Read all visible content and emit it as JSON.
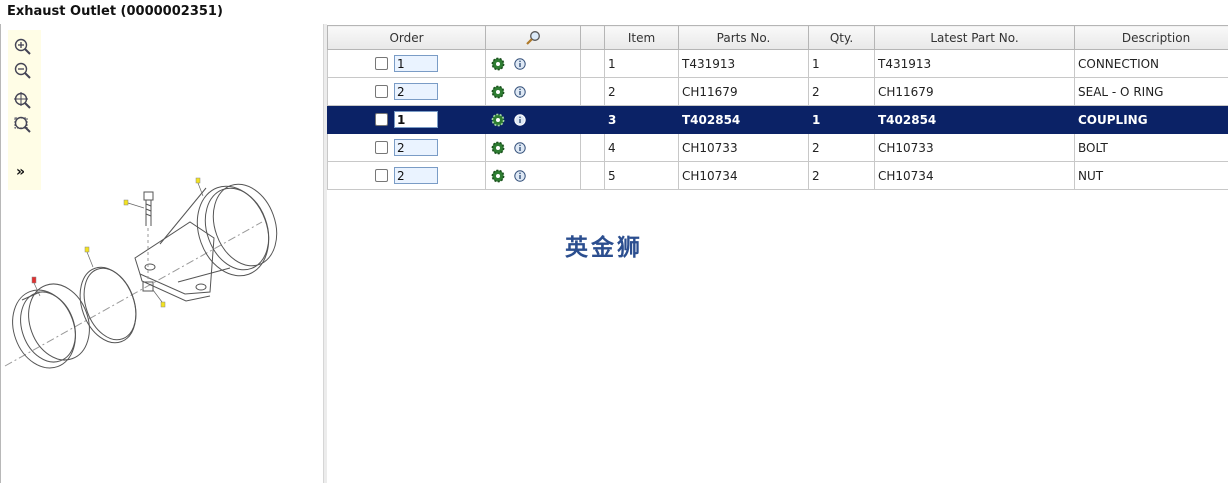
{
  "page": {
    "title": "Exhaust Outlet (0000002351)"
  },
  "toolbar": {
    "tools": [
      {
        "icon": "zoom-in-icon"
      },
      {
        "icon": "zoom-out-icon"
      },
      {
        "icon": "zoom-fit-icon"
      },
      {
        "icon": "zoom-window-icon"
      }
    ],
    "expand_label": "»"
  },
  "table": {
    "headers": {
      "order": "Order",
      "item": "Item",
      "parts_no": "Parts No.",
      "qty": "Qty.",
      "latest_part_no": "Latest Part No.",
      "description": "Description"
    },
    "rows": [
      {
        "order_qty": "1",
        "item": "1",
        "parts_no": "T431913",
        "qty": "1",
        "latest_part_no": "T431913",
        "description": "CONNECTION",
        "selected": false
      },
      {
        "order_qty": "2",
        "item": "2",
        "parts_no": "CH11679",
        "qty": "2",
        "latest_part_no": "CH11679",
        "description": "SEAL - O RING",
        "selected": false
      },
      {
        "order_qty": "1",
        "item": "3",
        "parts_no": "T402854",
        "qty": "1",
        "latest_part_no": "T402854",
        "description": "COUPLING",
        "selected": true
      },
      {
        "order_qty": "2",
        "item": "4",
        "parts_no": "CH10733",
        "qty": "2",
        "latest_part_no": "CH10733",
        "description": "BOLT",
        "selected": false
      },
      {
        "order_qty": "2",
        "item": "5",
        "parts_no": "CH10734",
        "qty": "2",
        "latest_part_no": "CH10734",
        "description": "NUT",
        "selected": false
      }
    ]
  },
  "watermark": {
    "text": "英金狮"
  },
  "colors": {
    "selected_row": "#0b2266",
    "accent": "#2b4e8f",
    "gear": "#2e7d32"
  }
}
